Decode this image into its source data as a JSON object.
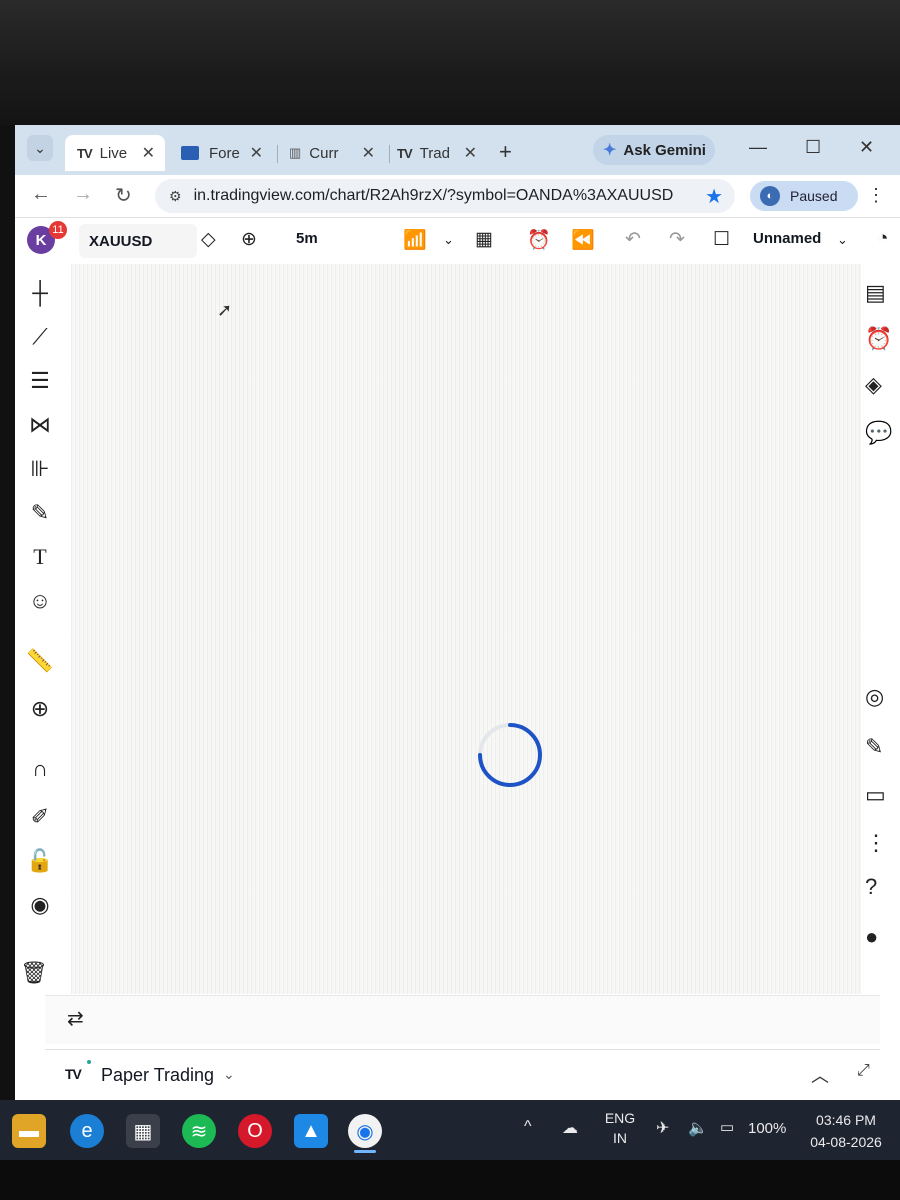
{
  "tabs": [
    {
      "label": "Live",
      "logo": "TV",
      "active": true
    },
    {
      "label": "Fore",
      "active": false
    },
    {
      "label": "Curr",
      "active": false
    },
    {
      "label": "Trad",
      "logo": "TV",
      "active": false
    }
  ],
  "gemini_label": "Ask Gemini",
  "address": {
    "url": "in.tradingview.com/chart/R2Ah9rzX/?symbol=OANDA%3AXAUUSD"
  },
  "profile_status": "Paused",
  "tv_header": {
    "avatar_letter": "K",
    "notification_count": "11",
    "symbol": "XAUUSD",
    "interval": "5m",
    "layout_name": "Unnamed"
  },
  "bottom_panel": {
    "logo": "TV",
    "label": "Paper Trading"
  },
  "taskbar": {
    "language": "ENG",
    "region": "IN",
    "battery": "100%",
    "time": "03:46 PM",
    "date": "04-08-2026"
  },
  "colors": {
    "spinner": "#1e53c8",
    "tab_strip": "#d3e1ef",
    "taskbar": "#1f2431"
  }
}
